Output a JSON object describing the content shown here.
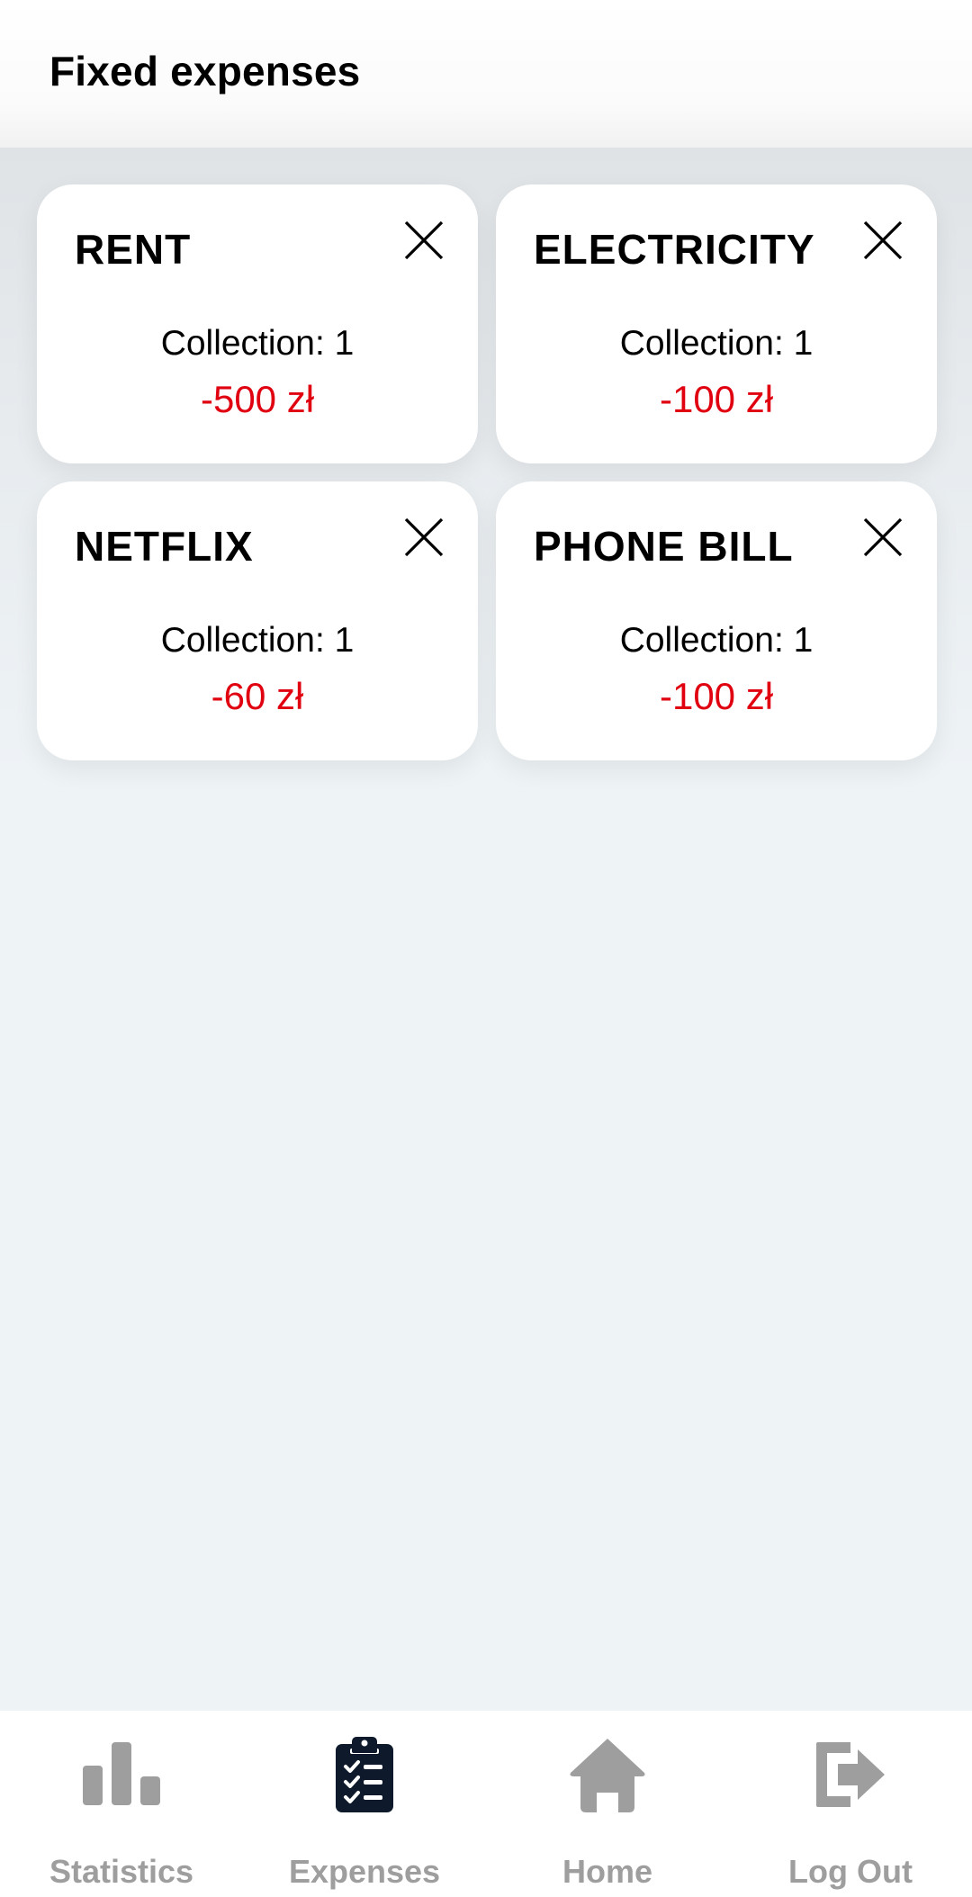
{
  "header": {
    "title": "Fixed expenses"
  },
  "expenses": [
    {
      "name": "RENT",
      "collection_label": "Collection: 1",
      "amount": "-500 zł"
    },
    {
      "name": "ELECTRICITY",
      "collection_label": "Collection: 1",
      "amount": "-100 zł"
    },
    {
      "name": "NETFLIX",
      "collection_label": "Collection: 1",
      "amount": "-60 zł"
    },
    {
      "name": "PHONE BILL",
      "collection_label": "Collection: 1",
      "amount": "-100 zł"
    }
  ],
  "card_icons": {
    "remove": "close-icon"
  },
  "bottom_nav": {
    "items": [
      {
        "label": "Statistics",
        "icon": "bar-chart-icon",
        "active": false
      },
      {
        "label": "Expenses",
        "icon": "clipboard-checklist-icon",
        "active": true
      },
      {
        "label": "Home",
        "icon": "home-icon",
        "active": false
      },
      {
        "label": "Log Out",
        "icon": "logout-icon",
        "active": false
      }
    ]
  },
  "colors": {
    "amount_negative": "#e00010",
    "nav_inactive": "#9e9e9e",
    "nav_active_icon": "#0e1a2b",
    "background": "#eef3f6",
    "card": "#ffffff"
  }
}
